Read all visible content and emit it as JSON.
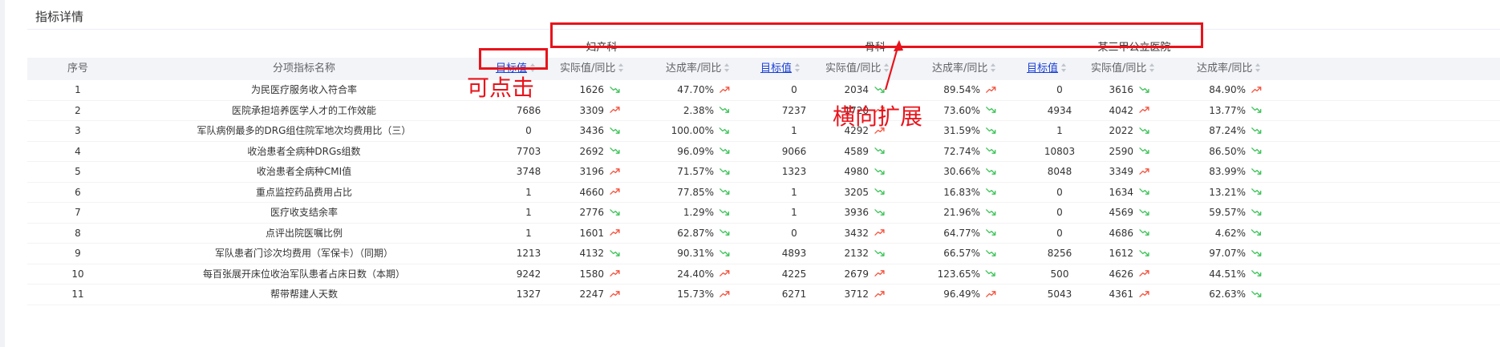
{
  "panel_title": "指标详情",
  "groups": [
    "妇产科",
    "骨科",
    "某三甲公立医院"
  ],
  "headers": {
    "index": "序号",
    "name": "分项指标名称",
    "target": "目标值",
    "actual": "实际值/同比",
    "rate": "达成率/同比"
  },
  "annotations": {
    "clickable": "可点击",
    "horizontal_expand": "横向扩展"
  },
  "colors": {
    "trend_up": "#f5543f",
    "trend_down": "#3ec45a",
    "annotation": "#e8131b",
    "link": "#1a3fd8"
  },
  "rows": [
    {
      "idx": "1",
      "name": "为民医疗服务收入符合率",
      "d": [
        {
          "target": "",
          "actual": "1626",
          "a_trend": "down",
          "rate": "47.70%",
          "r_trend": "up"
        },
        {
          "target": "0",
          "actual": "2034",
          "a_trend": "down",
          "rate": "89.54%",
          "r_trend": "up"
        },
        {
          "target": "0",
          "actual": "3616",
          "a_trend": "down",
          "rate": "84.90%",
          "r_trend": "up"
        }
      ]
    },
    {
      "idx": "2",
      "name": "医院承担培养医学人才的工作效能",
      "d": [
        {
          "target": "7686",
          "actual": "3309",
          "a_trend": "up",
          "rate": "2.38%",
          "r_trend": "down"
        },
        {
          "target": "7237",
          "actual": "1720",
          "a_trend": "up",
          "rate": "73.60%",
          "r_trend": "down"
        },
        {
          "target": "4934",
          "actual": "4042",
          "a_trend": "up",
          "rate": "13.77%",
          "r_trend": "down"
        }
      ]
    },
    {
      "idx": "3",
      "name": "军队病例最多的DRG组住院军地次均费用比（三）",
      "d": [
        {
          "target": "0",
          "actual": "3436",
          "a_trend": "down",
          "rate": "100.00%",
          "r_trend": "down"
        },
        {
          "target": "1",
          "actual": "4292",
          "a_trend": "up",
          "rate": "31.59%",
          "r_trend": "down"
        },
        {
          "target": "1",
          "actual": "2022",
          "a_trend": "down",
          "rate": "87.24%",
          "r_trend": "down"
        }
      ]
    },
    {
      "idx": "4",
      "name": "收治患者全病种DRGs组数",
      "d": [
        {
          "target": "7703",
          "actual": "2692",
          "a_trend": "down",
          "rate": "96.09%",
          "r_trend": "down"
        },
        {
          "target": "9066",
          "actual": "4589",
          "a_trend": "down",
          "rate": "72.74%",
          "r_trend": "down"
        },
        {
          "target": "10803",
          "actual": "2590",
          "a_trend": "down",
          "rate": "86.50%",
          "r_trend": "down"
        }
      ]
    },
    {
      "idx": "5",
      "name": "收治患者全病种CMI值",
      "d": [
        {
          "target": "3748",
          "actual": "3196",
          "a_trend": "up",
          "rate": "71.57%",
          "r_trend": "down"
        },
        {
          "target": "1323",
          "actual": "4980",
          "a_trend": "down",
          "rate": "30.66%",
          "r_trend": "down"
        },
        {
          "target": "8048",
          "actual": "3349",
          "a_trend": "up",
          "rate": "83.99%",
          "r_trend": "down"
        }
      ]
    },
    {
      "idx": "6",
      "name": "重点监控药品费用占比",
      "d": [
        {
          "target": "1",
          "actual": "4660",
          "a_trend": "up",
          "rate": "77.85%",
          "r_trend": "down"
        },
        {
          "target": "1",
          "actual": "3205",
          "a_trend": "down",
          "rate": "16.83%",
          "r_trend": "down"
        },
        {
          "target": "0",
          "actual": "1634",
          "a_trend": "down",
          "rate": "13.21%",
          "r_trend": "down"
        }
      ]
    },
    {
      "idx": "7",
      "name": "医疗收支结余率",
      "d": [
        {
          "target": "1",
          "actual": "2776",
          "a_trend": "down",
          "rate": "1.29%",
          "r_trend": "down"
        },
        {
          "target": "1",
          "actual": "3936",
          "a_trend": "down",
          "rate": "21.96%",
          "r_trend": "down"
        },
        {
          "target": "0",
          "actual": "4569",
          "a_trend": "down",
          "rate": "59.57%",
          "r_trend": "down"
        }
      ]
    },
    {
      "idx": "8",
      "name": "点评出院医嘱比例",
      "d": [
        {
          "target": "1",
          "actual": "1601",
          "a_trend": "up",
          "rate": "62.87%",
          "r_trend": "down"
        },
        {
          "target": "0",
          "actual": "3432",
          "a_trend": "up",
          "rate": "64.77%",
          "r_trend": "down"
        },
        {
          "target": "0",
          "actual": "4686",
          "a_trend": "down",
          "rate": "4.62%",
          "r_trend": "down"
        }
      ]
    },
    {
      "idx": "9",
      "name": "军队患者门诊次均费用（军保卡）（同期）",
      "d": [
        {
          "target": "1213",
          "actual": "4132",
          "a_trend": "down",
          "rate": "90.31%",
          "r_trend": "down"
        },
        {
          "target": "4893",
          "actual": "2132",
          "a_trend": "down",
          "rate": "66.57%",
          "r_trend": "down"
        },
        {
          "target": "8256",
          "actual": "1612",
          "a_trend": "down",
          "rate": "97.07%",
          "r_trend": "down"
        }
      ]
    },
    {
      "idx": "10",
      "name": "每百张展开床位收治军队患者占床日数（本期）",
      "d": [
        {
          "target": "9242",
          "actual": "1580",
          "a_trend": "up",
          "rate": "24.40%",
          "r_trend": "up"
        },
        {
          "target": "4225",
          "actual": "2679",
          "a_trend": "up",
          "rate": "123.65%",
          "r_trend": "down"
        },
        {
          "target": "500",
          "actual": "4626",
          "a_trend": "up",
          "rate": "44.51%",
          "r_trend": "down"
        }
      ]
    },
    {
      "idx": "11",
      "name": "帮带帮建人天数",
      "d": [
        {
          "target": "1327",
          "actual": "2247",
          "a_trend": "up",
          "rate": "15.73%",
          "r_trend": "up"
        },
        {
          "target": "6271",
          "actual": "3712",
          "a_trend": "up",
          "rate": "96.49%",
          "r_trend": "up"
        },
        {
          "target": "5043",
          "actual": "4361",
          "a_trend": "up",
          "rate": "62.63%",
          "r_trend": "down"
        }
      ]
    }
  ]
}
